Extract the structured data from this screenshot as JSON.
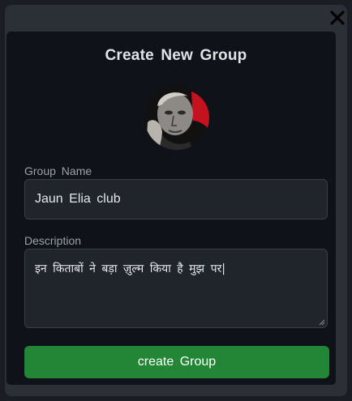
{
  "dialog": {
    "title": "Create New Group",
    "close_icon": "close-icon",
    "avatar": "group-avatar-image"
  },
  "form": {
    "group_name_label": "Group Name",
    "group_name_value": "Jaun Elia club",
    "description_label": "Description",
    "description_value": "इन किताबों ने बड़ा ज़ुल्म किया है मुझ पर|",
    "submit_label": "create Group"
  },
  "colors": {
    "overlay": "#2b3037",
    "card": "#0f1218",
    "field_bg": "#20242b",
    "accent_button": "#238636"
  }
}
